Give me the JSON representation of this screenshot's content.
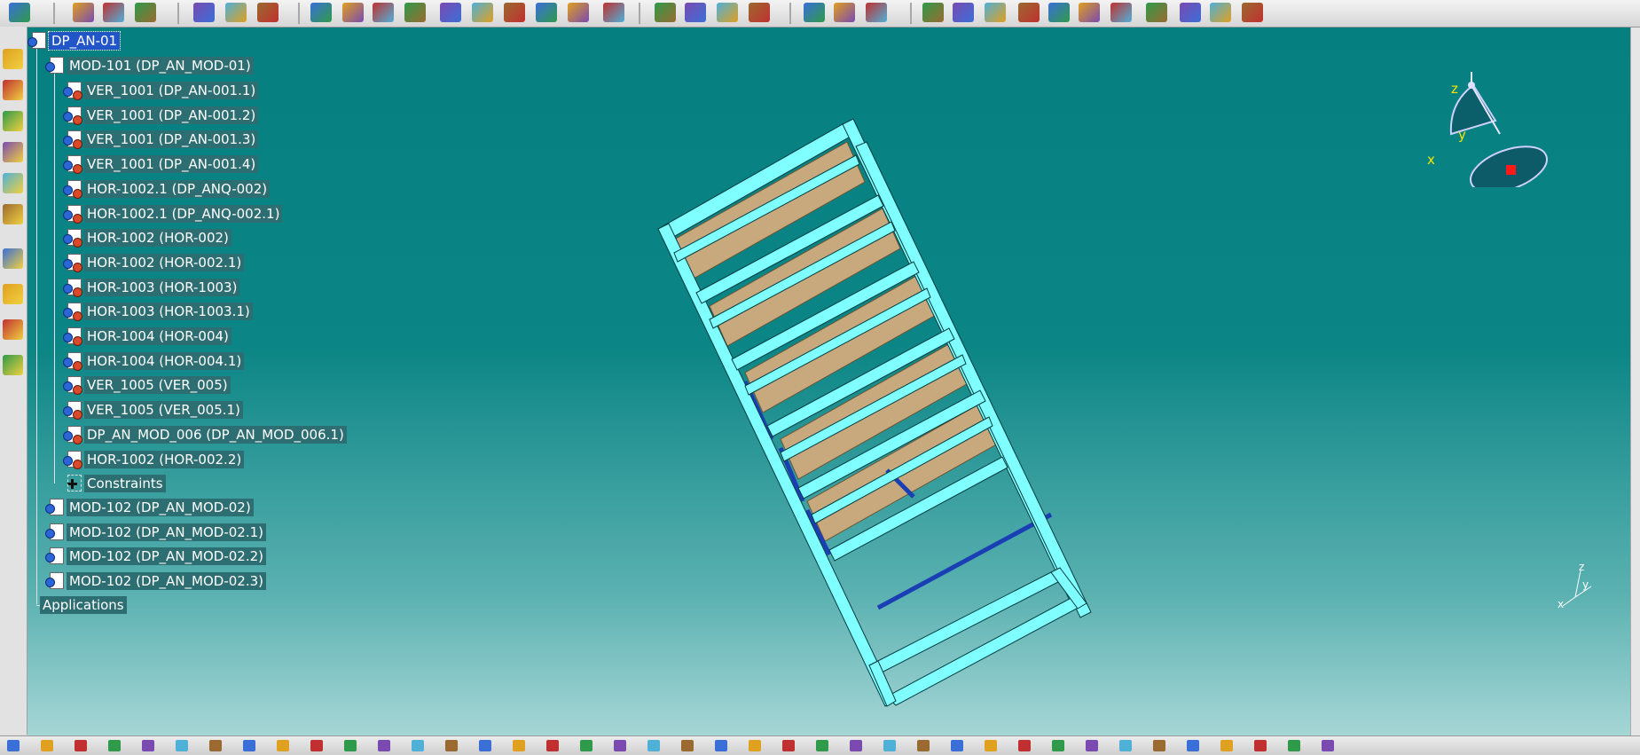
{
  "tree": {
    "root": {
      "label": "DP_AN-01"
    },
    "product": {
      "label": "MOD-101 (DP_AN_MOD-01)"
    },
    "children": [
      {
        "label": "VER_1001 (DP_AN-001.1)"
      },
      {
        "label": "VER_1001 (DP_AN-001.2)"
      },
      {
        "label": "VER_1001 (DP_AN-001.3)"
      },
      {
        "label": "VER_1001 (DP_AN-001.4)"
      },
      {
        "label": "HOR-1002.1 (DP_ANQ-002)"
      },
      {
        "label": "HOR-1002.1 (DP_ANQ-002.1)"
      },
      {
        "label": "HOR-1002 (HOR-002)"
      },
      {
        "label": "HOR-1002 (HOR-002.1)"
      },
      {
        "label": "HOR-1003 (HOR-1003)"
      },
      {
        "label": "HOR-1003 (HOR-1003.1)"
      },
      {
        "label": "HOR-1004 (HOR-004)"
      },
      {
        "label": "HOR-1004 (HOR-004.1)"
      },
      {
        "label": "VER_1005 (VER_005)"
      },
      {
        "label": "VER_1005 (VER_005.1)"
      },
      {
        "label": "DP_AN_MOD_006 (DP_AN_MOD_006.1)"
      },
      {
        "label": "HOR-1002 (HOR-002.2)"
      },
      {
        "label": "Constraints"
      }
    ],
    "siblings": [
      {
        "label": "MOD-102 (DP_AN_MOD-02)"
      },
      {
        "label": "MOD-102 (DP_AN_MOD-02.1)"
      },
      {
        "label": "MOD-102 (DP_AN_MOD-02.2)"
      },
      {
        "label": "MOD-102 (DP_AN_MOD-02.3)"
      }
    ],
    "applications": {
      "label": "Applications"
    }
  },
  "compass": {
    "z": "z",
    "y": "y",
    "x": "x"
  },
  "axis_small": {
    "z": "z",
    "y": "y",
    "x": "x"
  },
  "colors": {
    "viewport_top": "#057f80",
    "viewport_bottom": "#a6d6d6",
    "frame_tube": "#7fffff",
    "shelf": "#c8a97e",
    "tree_label_bg": "#2d6e72",
    "selection": "#2155c8"
  }
}
